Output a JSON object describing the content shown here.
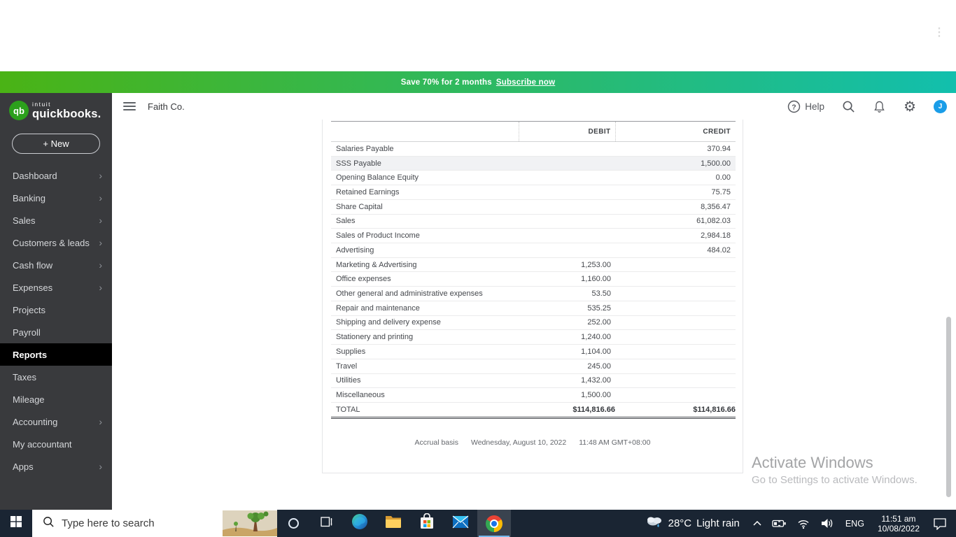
{
  "browser": {
    "overflow_menu_icon": "⋮"
  },
  "banner": {
    "message": "Save 70% for 2 months",
    "link_label": "Subscribe now",
    "gradient_left": "#4ab315",
    "gradient_right": "#12bfad"
  },
  "brand": {
    "logo_initials": "qb",
    "intuit": "intuit",
    "product": "quickbooks.",
    "qb_green": "#2ca01c",
    "new_button_label": "+ New"
  },
  "sidebar": {
    "chevron_glyph": "›",
    "items": [
      {
        "label": "Dashboard",
        "chevron": true,
        "selected": false
      },
      {
        "label": "Banking",
        "chevron": true,
        "selected": false
      },
      {
        "label": "Sales",
        "chevron": true,
        "selected": false
      },
      {
        "label": "Customers & leads",
        "chevron": true,
        "selected": false
      },
      {
        "label": "Cash flow",
        "chevron": true,
        "selected": false
      },
      {
        "label": "Expenses",
        "chevron": true,
        "selected": false
      },
      {
        "label": "Projects",
        "chevron": false,
        "selected": false
      },
      {
        "label": "Payroll",
        "chevron": false,
        "selected": false
      },
      {
        "label": "Reports",
        "chevron": false,
        "selected": true
      },
      {
        "label": "Taxes",
        "chevron": false,
        "selected": false
      },
      {
        "label": "Mileage",
        "chevron": false,
        "selected": false
      },
      {
        "label": "Accounting",
        "chevron": true,
        "selected": false
      },
      {
        "label": "My accountant",
        "chevron": false,
        "selected": false
      },
      {
        "label": "Apps",
        "chevron": true,
        "selected": false
      }
    ]
  },
  "header": {
    "company_name": "Faith Co.",
    "help_label": "Help",
    "avatar_initial": "J",
    "avatar_color": "#1a9de8"
  },
  "report": {
    "columns": {
      "debit": "DEBIT",
      "credit": "CREDIT"
    },
    "rows": [
      {
        "account": "Salaries Payable",
        "debit": "",
        "credit": "370.94",
        "highlighted": false
      },
      {
        "account": "SSS Payable",
        "debit": "",
        "credit": "1,500.00",
        "highlighted": true
      },
      {
        "account": "Opening Balance Equity",
        "debit": "",
        "credit": "0.00",
        "highlighted": false
      },
      {
        "account": "Retained Earnings",
        "debit": "",
        "credit": "75.75",
        "highlighted": false
      },
      {
        "account": "Share Capital",
        "debit": "",
        "credit": "8,356.47",
        "highlighted": false
      },
      {
        "account": "Sales",
        "debit": "",
        "credit": "61,082.03",
        "highlighted": false
      },
      {
        "account": "Sales of Product Income",
        "debit": "",
        "credit": "2,984.18",
        "highlighted": false
      },
      {
        "account": "Advertising",
        "debit": "",
        "credit": "484.02",
        "highlighted": false
      },
      {
        "account": "Marketing & Advertising",
        "debit": "1,253.00",
        "credit": "",
        "highlighted": false
      },
      {
        "account": "Office expenses",
        "debit": "1,160.00",
        "credit": "",
        "highlighted": false
      },
      {
        "account": "Other general and administrative expenses",
        "debit": "53.50",
        "credit": "",
        "highlighted": false
      },
      {
        "account": "Repair and maintenance",
        "debit": "535.25",
        "credit": "",
        "highlighted": false
      },
      {
        "account": "Shipping and delivery expense",
        "debit": "252.00",
        "credit": "",
        "highlighted": false
      },
      {
        "account": "Stationery and printing",
        "debit": "1,240.00",
        "credit": "",
        "highlighted": false
      },
      {
        "account": "Supplies",
        "debit": "1,104.00",
        "credit": "",
        "highlighted": false
      },
      {
        "account": "Travel",
        "debit": "245.00",
        "credit": "",
        "highlighted": false
      },
      {
        "account": "Utilities",
        "debit": "1,432.00",
        "credit": "",
        "highlighted": false
      },
      {
        "account": "Miscellaneous",
        "debit": "1,500.00",
        "credit": "",
        "highlighted": false
      }
    ],
    "total": {
      "label": "TOTAL",
      "debit": "$114,816.66",
      "credit": "$114,816.66"
    },
    "footer": {
      "basis": "Accrual basis",
      "date": "Wednesday, August 10, 2022",
      "time": "11:48 AM GMT+08:00"
    }
  },
  "watermark": {
    "line1": "Activate Windows",
    "line2": "Go to Settings to activate Windows."
  },
  "taskbar": {
    "search_placeholder": "Type here to search",
    "weather_temp": "28°C",
    "weather_desc": "Light rain",
    "language": "ENG",
    "time": "11:51 am",
    "date": "10/08/2022"
  }
}
